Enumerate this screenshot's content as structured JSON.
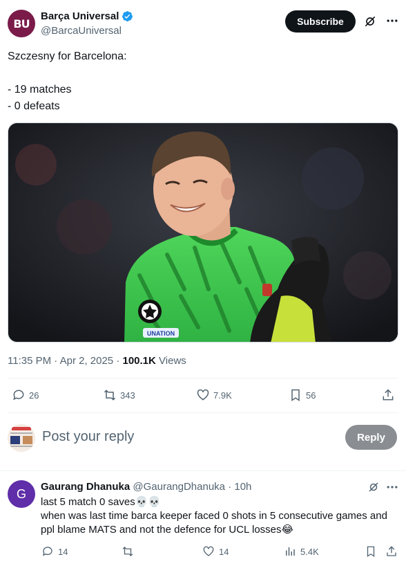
{
  "post": {
    "author_name": "Barça Universal",
    "author_handle": "@BarcaUniversal",
    "avatar_text": "BU",
    "subscribe_label": "Subscribe",
    "text_lines": [
      "Szczesny for Barcelona:",
      "",
      "- 19 matches",
      "- 0 defeats"
    ],
    "media_alt": "Wojciech Szczesny smiling and clapping in a green Barcelona goalkeeper kit",
    "kit_badge_text": "UNATION",
    "timestamp": "11:35 PM · Apr 2, 2025 · ",
    "views_count": "100.1K",
    "views_label": "Views",
    "stats": {
      "replies": "26",
      "reposts": "343",
      "likes": "7.9K",
      "bookmarks": "56"
    }
  },
  "composer": {
    "placeholder": "Post your reply",
    "reply_label": "Reply"
  },
  "comment": {
    "avatar_letter": "G",
    "author_name": "Gaurang Dhanuka",
    "author_handle": "@GaurangDhanuka",
    "time": "10h",
    "line1": "last 5 match 0 saves💀💀",
    "line2": "when was last time barca keeper faced 0 shots in 5 consecutive games and ppl blame MATS and not the defence for UCL losses😂",
    "stats": {
      "replies": "14",
      "likes": "14",
      "views": "5.4K"
    }
  },
  "colors": {
    "text": "#0f1419",
    "secondary": "#536471",
    "verified": "#1d9bf0",
    "brand_avatar": "#7a1b4a",
    "reply_avatar": "#5f2ea8"
  }
}
